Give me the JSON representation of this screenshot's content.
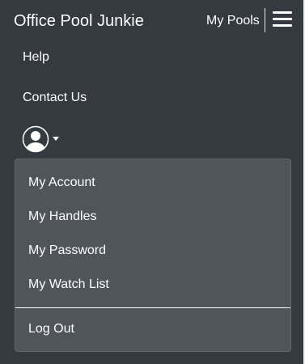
{
  "navbar": {
    "brand": "Office Pool Junkie",
    "my_pools": "My Pools",
    "links": {
      "help": "Help",
      "contact": "Contact Us"
    },
    "icons": {
      "menu": "hamburger-menu-icon",
      "user": "user-circle-icon",
      "caret": "caret-down-icon"
    }
  },
  "user_menu": {
    "items": [
      "My Account",
      "My Handles",
      "My Password",
      "My Watch List"
    ],
    "logout": "Log Out"
  },
  "colors": {
    "navbar_bg": "#343a40",
    "dropdown_bg": "#50555b",
    "text": "#ffffff"
  }
}
